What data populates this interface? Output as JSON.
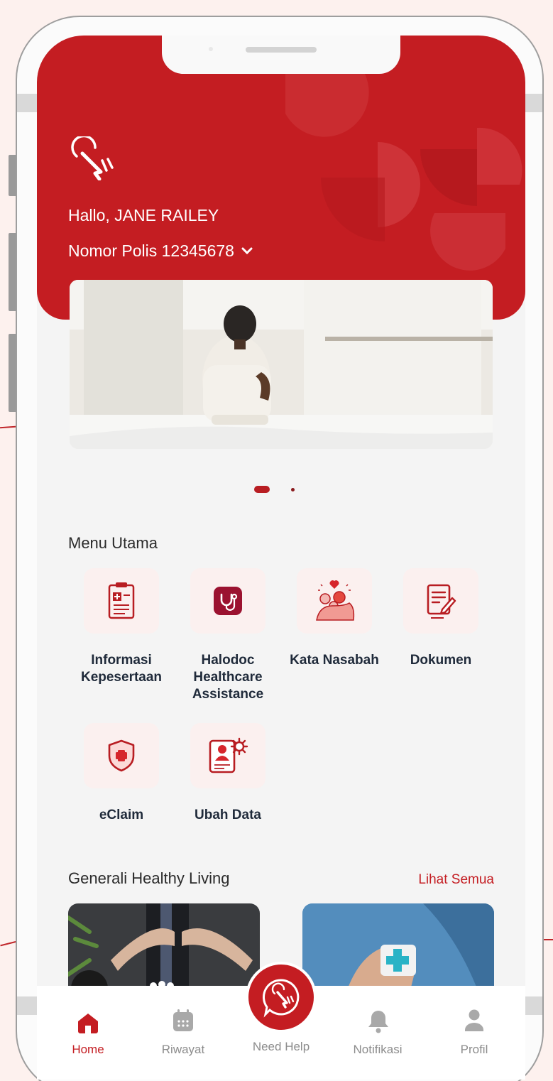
{
  "header": {
    "greeting": "Hallo, JANE RAILEY",
    "policy": "Nomor Polis 12345678"
  },
  "carousel": {
    "slides": 2,
    "active_index": 0
  },
  "main_menu": {
    "title": "Menu Utama",
    "items": [
      {
        "label_line1": "Informasi",
        "label_line2": "Kepesertaan",
        "label_line3": "",
        "icon": "clipboard-medical-icon"
      },
      {
        "label_line1": "Halodoc",
        "label_line2": "Healthcare",
        "label_line3": "Assistance",
        "icon": "halodoc-stethoscope-icon"
      },
      {
        "label_line1": "Kata Nasabah",
        "label_line2": "",
        "label_line3": "",
        "icon": "family-testimonial-icon"
      },
      {
        "label_line1": "Dokumen",
        "label_line2": "",
        "label_line3": "",
        "icon": "document-edit-icon"
      },
      {
        "label_line1": "eClaim",
        "label_line2": "",
        "label_line3": "",
        "icon": "shield-cross-icon"
      },
      {
        "label_line1": "Ubah Data",
        "label_line2": "",
        "label_line3": "",
        "icon": "profile-settings-icon"
      }
    ]
  },
  "healthy_living": {
    "title": "Generali Healthy Living",
    "see_all": "Lihat Semua"
  },
  "tabbar": {
    "home": "Home",
    "history": "Riwayat",
    "help": "Need Help",
    "notifications": "Notifikasi",
    "profile": "Profil"
  },
  "colors": {
    "brand": "#c41d22",
    "tile_bg": "#fbf0ef",
    "label": "#1f2a3a"
  }
}
